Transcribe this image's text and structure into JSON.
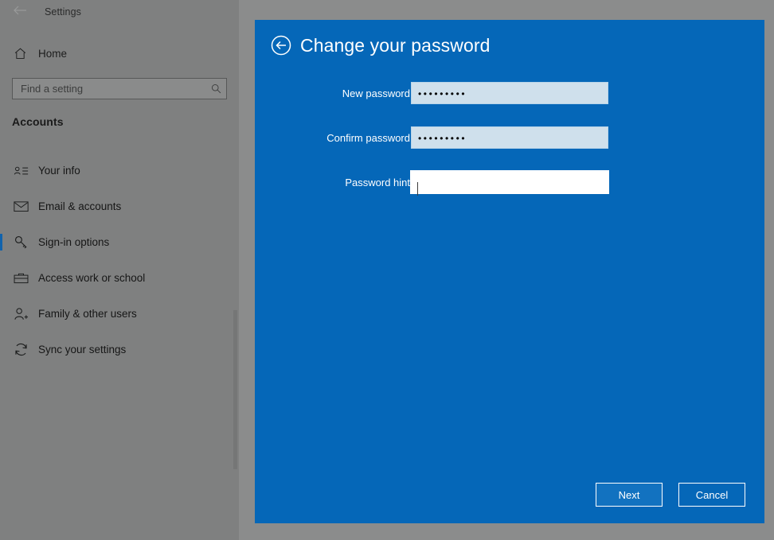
{
  "window": {
    "app_title": "Settings",
    "back_chevron_icon": "back-arrow-icon"
  },
  "sidebar": {
    "home_label": "Home",
    "home_icon": "home-icon",
    "search": {
      "placeholder": "Find a setting",
      "value": "",
      "icon": "search-icon"
    },
    "section_title": "Accounts",
    "items": [
      {
        "label": "Your info",
        "icon": "contact-card-icon",
        "selected": false
      },
      {
        "label": "Email & accounts",
        "icon": "envelope-icon",
        "selected": false
      },
      {
        "label": "Sign-in options",
        "icon": "key-icon",
        "selected": true
      },
      {
        "label": "Access work or school",
        "icon": "briefcase-icon",
        "selected": false
      },
      {
        "label": "Family & other users",
        "icon": "person-add-icon",
        "selected": false
      },
      {
        "label": "Sync your settings",
        "icon": "sync-refresh-icon",
        "selected": false
      }
    ]
  },
  "panel": {
    "title": "Change your password",
    "back_icon": "circle-back-arrow-icon",
    "fields": [
      {
        "label": "New password",
        "value": "•••••••••",
        "type": "password",
        "focused": false
      },
      {
        "label": "Confirm password",
        "value": "•••••••••",
        "type": "password",
        "focused": false
      },
      {
        "label": "Password hint",
        "value": "",
        "type": "text",
        "focused": true
      }
    ],
    "buttons": {
      "next": "Next",
      "cancel": "Cancel"
    }
  },
  "colors": {
    "panel_blue": "#0567b8",
    "accent_blue": "#1063ad",
    "sidebar_gray": "#7f8080",
    "page_gray": "#8b8c8c",
    "input_fill": "#cfe0ec",
    "input_focus_fill": "#ffffff",
    "text_white": "#ffffff"
  }
}
